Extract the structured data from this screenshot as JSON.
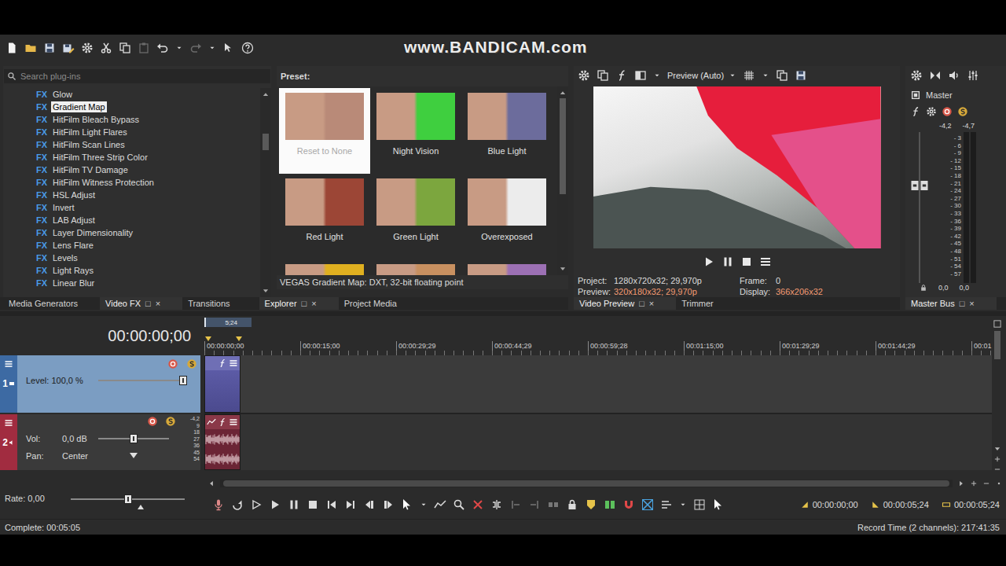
{
  "watermark": "www.BANDICAM.com",
  "plugins": {
    "search": {
      "placeholder": "Search plug-ins"
    },
    "fx_badge": "FX",
    "scroll": 0.2,
    "items": [
      {
        "label": "Glow",
        "selected": false
      },
      {
        "label": "Gradient Map",
        "selected": true
      },
      {
        "label": "HitFilm Bleach Bypass",
        "selected": false
      },
      {
        "label": "HitFilm Light Flares",
        "selected": false
      },
      {
        "label": "HitFilm Scan Lines",
        "selected": false
      },
      {
        "label": "HitFilm Three Strip Color",
        "selected": false
      },
      {
        "label": "HitFilm TV Damage",
        "selected": false
      },
      {
        "label": "HitFilm Witness Protection",
        "selected": false
      },
      {
        "label": "HSL Adjust",
        "selected": false
      },
      {
        "label": "Invert",
        "selected": false
      },
      {
        "label": "LAB Adjust",
        "selected": false
      },
      {
        "label": "Layer Dimensionality",
        "selected": false
      },
      {
        "label": "Lens Flare",
        "selected": false
      },
      {
        "label": "Levels",
        "selected": false
      },
      {
        "label": "Light Rays",
        "selected": false
      },
      {
        "label": "Linear Blur",
        "selected": false
      }
    ]
  },
  "presets": {
    "title": "Preset:",
    "scroll": 0.0,
    "items": [
      {
        "label": "Reset to None",
        "selected": true,
        "color": "#b98a78"
      },
      {
        "label": "Night Vision",
        "selected": false,
        "color": "#3fcf3f"
      },
      {
        "label": "Blue Light",
        "selected": false,
        "color": "#6c6c9c"
      },
      {
        "label": "Red Light",
        "selected": false,
        "color": "#9c4636"
      },
      {
        "label": "Green Light",
        "selected": false,
        "color": "#7ca63e"
      },
      {
        "label": "Overexposed",
        "selected": false,
        "color": "#ececec"
      }
    ],
    "partial_row": [
      {
        "color": "#e0b020"
      },
      {
        "color": "#c89060"
      },
      {
        "color": "#9c70b4"
      }
    ],
    "description": "VEGAS Gradient Map: DXT, 32-bit floating point"
  },
  "preview": {
    "mode": "Preview (Auto)",
    "info": [
      {
        "label": "Project:",
        "value": "1280x720x32; 29,970p",
        "highlighted": false
      },
      {
        "label": "Frame:",
        "value": "0",
        "highlighted": false
      },
      {
        "label": "Preview:",
        "value": "320x180x32; 29,970p",
        "highlighted": true
      },
      {
        "label": "Display:",
        "value": "366x206x32",
        "highlighted": true
      }
    ]
  },
  "master": {
    "title": "Master",
    "peaks": [
      "-4,2",
      "-4,7"
    ],
    "scale": [
      "- 3",
      "- 6",
      "- 9",
      "- 12",
      "- 15",
      "- 18",
      "- 21",
      "- 24",
      "- 27",
      "- 30",
      "- 33",
      "- 36",
      "- 39",
      "- 42",
      "- 45",
      "- 48",
      "- 51",
      "- 54",
      "- 57"
    ],
    "readouts": [
      "0,0",
      "0,0"
    ],
    "fader_level": 0.67,
    "meter_levels": [
      0,
      0
    ]
  },
  "dock_glyph": "□",
  "close_glyph": "×",
  "tab_groups": [
    {
      "tabs": [
        {
          "label": "Media Generators",
          "selected": false
        },
        {
          "label": "Video FX",
          "selected": true
        },
        {
          "label": "Transitions",
          "selected": false
        }
      ]
    },
    {
      "tabs": [
        {
          "label": "Explorer",
          "selected": true
        },
        {
          "label": "Project Media",
          "selected": false
        }
      ]
    },
    {
      "tabs": [
        {
          "label": "Video Preview",
          "selected": true
        },
        {
          "label": "Trimmer",
          "selected": false
        }
      ]
    },
    {
      "tabs": [
        {
          "label": "Master Bus",
          "selected": true
        }
      ]
    }
  ],
  "timeline": {
    "cursor_time": "00:00:00;00",
    "loop_length": "5;24",
    "scroll": 0.0,
    "ruler": [
      "00:00:00;00",
      "00:00:15;00",
      "00:00:29;29",
      "00:00:44;29",
      "00:00:59;28",
      "00:01:15;00",
      "00:01:29;29",
      "00:01:44;29",
      "00:01"
    ],
    "tracks": [
      {
        "number": "1",
        "kind": "video",
        "selected": true,
        "color": "#3d6aa3",
        "level_label": "Level: 100,0 %",
        "level": 1.0
      },
      {
        "number": "2",
        "kind": "audio",
        "selected": false,
        "color": "#a12c40",
        "vol_label": "Vol:",
        "vol_value": "0,0 dB",
        "vol_level": 0.5,
        "pan_label": "Pan:",
        "pan_value": "Center",
        "pan_level": 0.5,
        "peak": "-4,2",
        "meter_scale": [
          "9",
          "18",
          "27",
          "36",
          "45",
          "54"
        ]
      }
    ],
    "rate": {
      "label": "Rate: 0,00",
      "level": 0.5
    }
  },
  "transport": {
    "times": [
      "00:00:00;00",
      "00:00:05;24",
      "00:00:05;24"
    ]
  },
  "status_bar": {
    "left": "Complete: 00:05:05",
    "right": "Record Time (2 channels): 217:41:35"
  }
}
